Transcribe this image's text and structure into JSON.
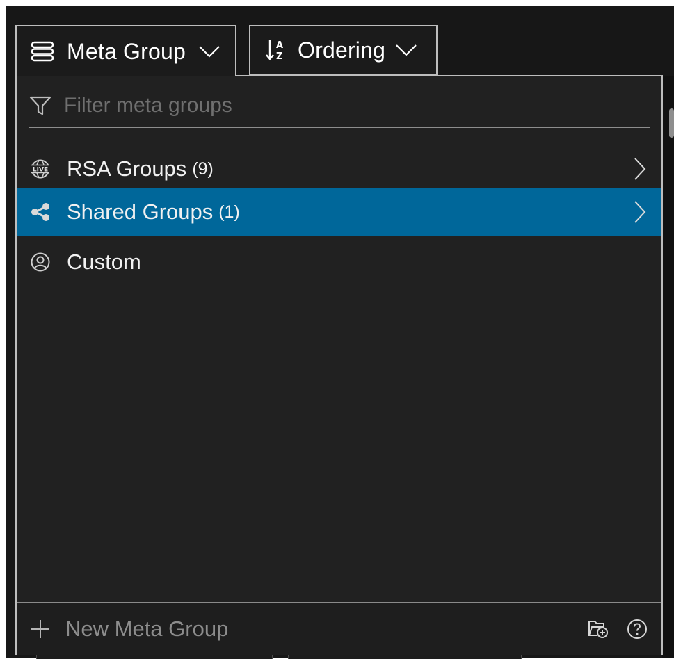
{
  "toolbar": {
    "meta_group_label": "Meta Group",
    "ordering_label": "Ordering"
  },
  "filter": {
    "placeholder": "Filter meta groups",
    "value": ""
  },
  "groups": [
    {
      "label": "RSA Groups",
      "count": "(9)",
      "icon": "live-globe-icon",
      "selected": false,
      "has_submenu": true
    },
    {
      "label": "Shared Groups",
      "count": "(1)",
      "icon": "share-icon",
      "selected": true,
      "has_submenu": true
    },
    {
      "label": "Custom",
      "count": "",
      "icon": "user-circle-icon",
      "selected": false,
      "has_submenu": false
    }
  ],
  "footer": {
    "new_label": "New Meta Group"
  },
  "colors": {
    "selected_row": "#00679a",
    "panel_bg": "#212121",
    "border": "#bdbdbd"
  }
}
